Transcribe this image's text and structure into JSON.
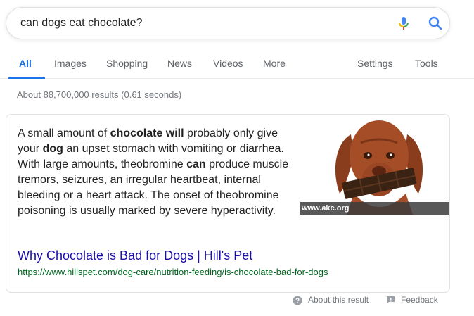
{
  "search": {
    "query": "can dogs eat chocolate?",
    "mic_icon": "mic-icon",
    "search_icon": "search-icon"
  },
  "tabs": {
    "items": [
      {
        "label": "All",
        "active": true
      },
      {
        "label": "Images"
      },
      {
        "label": "Shopping"
      },
      {
        "label": "News"
      },
      {
        "label": "Videos"
      },
      {
        "label": "More"
      }
    ],
    "settings": "Settings",
    "tools": "Tools"
  },
  "stats": "About 88,700,000 results (0.61 seconds)",
  "snippet": {
    "parts": [
      {
        "text": "A small amount of "
      },
      {
        "text": "chocolate will",
        "bold": true
      },
      {
        "text": " probably only give your "
      },
      {
        "text": "dog",
        "bold": true
      },
      {
        "text": " an upset stomach with vomiting or diarrhea. With large amounts, theobromine "
      },
      {
        "text": "can",
        "bold": true
      },
      {
        "text": " produce muscle tremors, seizures, an irregular heartbeat, internal bleeding or a heart attack. The onset of theobromine poisoning is usually marked by severe hyperactivity."
      }
    ],
    "image_caption": "www.akc.org",
    "result_title": "Why Chocolate is Bad for Dogs | Hill's Pet",
    "result_url": "https://www.hillspet.com/dog-care/nutrition-feeding/is-chocolate-bad-for-dogs"
  },
  "footer": {
    "about": "About this result",
    "feedback": "Feedback"
  },
  "colors": {
    "link": "#1a0dab",
    "url": "#006621",
    "accent": "#1a73e8"
  }
}
